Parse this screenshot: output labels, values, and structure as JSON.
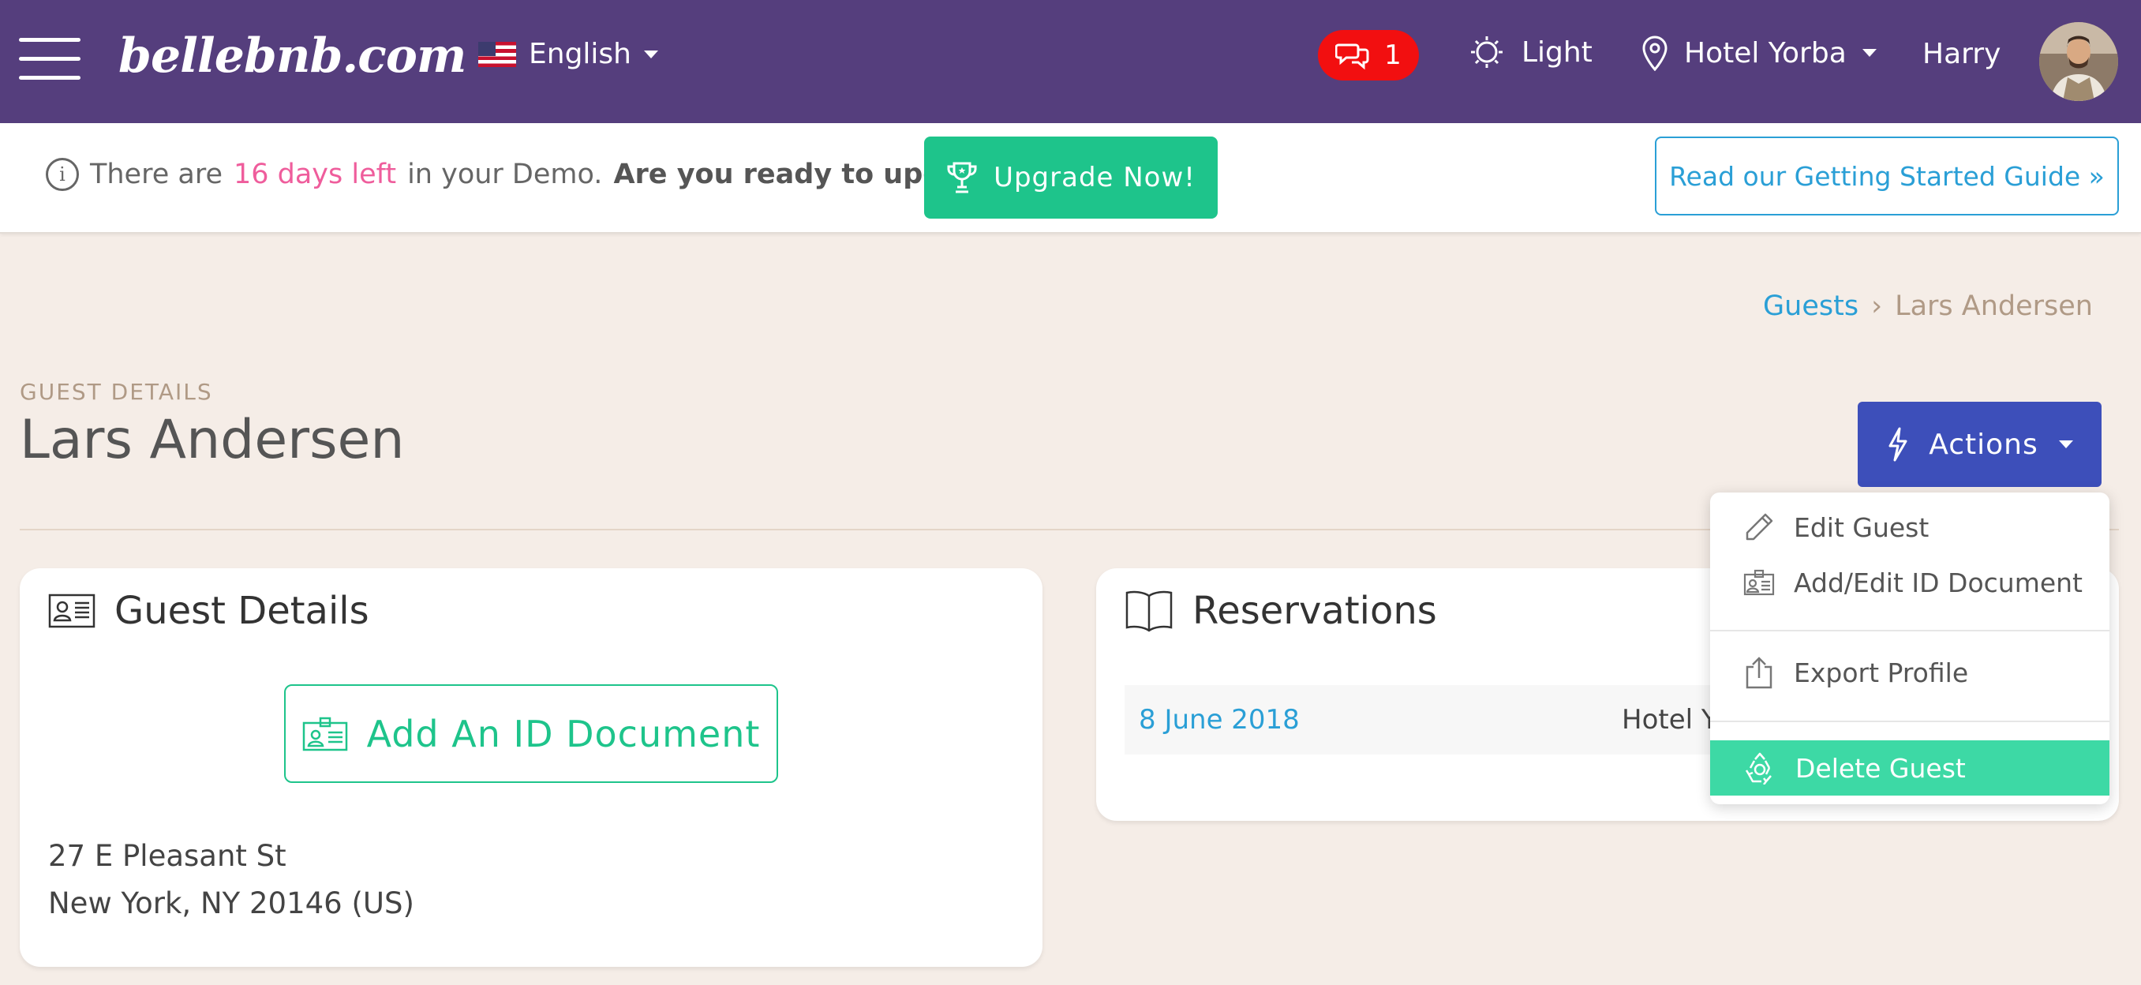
{
  "header": {
    "logo": "bellebnb.com",
    "language": "English",
    "messages_count": "1",
    "theme": "Light",
    "hotel": "Hotel Yorba",
    "user": "Harry"
  },
  "banner": {
    "text_before": "There are",
    "days_left": "16 days left",
    "text_after": "in your Demo.",
    "question": "Are you ready to upgrade?",
    "upgrade_label": "Upgrade Now!",
    "guide_label": "Read our Getting Started Guide »"
  },
  "breadcrumb": {
    "parent": "Guests",
    "separator": "›",
    "current": "Lars Andersen"
  },
  "page": {
    "subtitle": "GUEST DETAILS",
    "title": "Lars Andersen",
    "actions_label": "Actions"
  },
  "actions_menu": {
    "items": [
      {
        "label": "Edit Guest",
        "icon": "pencil-icon"
      },
      {
        "label": "Add/Edit ID Document",
        "icon": "id-card-icon"
      },
      {
        "label": "Export Profile",
        "icon": "export-icon"
      },
      {
        "label": "Delete Guest",
        "icon": "recycle-icon"
      }
    ]
  },
  "guest_card": {
    "title": "Guest Details",
    "add_id_label": "Add An ID Document",
    "address_line1": "27 E Pleasant St",
    "address_line2": "New York, NY 20146 (US)"
  },
  "reservations_card": {
    "title": "Reservations",
    "rows": [
      {
        "date": "8 June 2018",
        "hotel": "Hotel Yorba"
      }
    ]
  },
  "colors": {
    "topbar": "#553e7d",
    "accent_green": "#1ec48b",
    "link_blue": "#2a9fd6",
    "actions_blue": "#3d4fba",
    "badge_red": "#f20f10",
    "highlight_pink": "#ef5d9c",
    "page_bg": "#f5ede7"
  }
}
